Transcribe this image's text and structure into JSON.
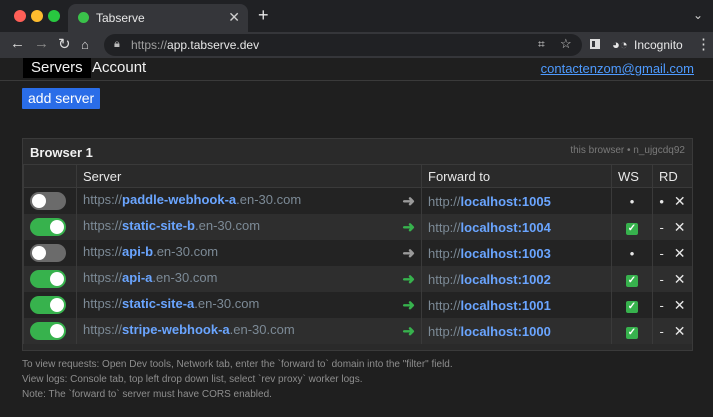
{
  "browser": {
    "tab_title": "Tabserve",
    "tab_close": "✕",
    "new_tab": "+",
    "url_scheme": "https://",
    "url_host": "app.tabserve.dev",
    "incognito_label": "Incognito",
    "traffic_colors": [
      "#ff5f57",
      "#febc2e",
      "#28c840"
    ]
  },
  "nav": {
    "servers": "Servers",
    "account": "Account",
    "email": "contactenzom@gmail.com"
  },
  "add_server": "add server",
  "panel": {
    "title": "Browser 1",
    "meta": "this browser • n_ujgcdq92",
    "headers": {
      "server": "Server",
      "forward": "Forward to",
      "ws": "WS",
      "rd": "RD"
    },
    "rows": [
      {
        "enabled": false,
        "scheme": "https://",
        "sub": "paddle-webhook-a",
        "domain": ".en-30.com",
        "fwd_scheme": "http://",
        "fwd_host": "localhost:1005",
        "ws": "•",
        "rd": "•"
      },
      {
        "enabled": true,
        "scheme": "https://",
        "sub": "static-site-b",
        "domain": ".en-30.com",
        "fwd_scheme": "http://",
        "fwd_host": "localhost:1004",
        "ws": "check",
        "rd": "-"
      },
      {
        "enabled": false,
        "scheme": "https://",
        "sub": "api-b",
        "domain": ".en-30.com",
        "fwd_scheme": "http://",
        "fwd_host": "localhost:1003",
        "ws": "•",
        "rd": "-"
      },
      {
        "enabled": true,
        "scheme": "https://",
        "sub": "api-a",
        "domain": ".en-30.com",
        "fwd_scheme": "http://",
        "fwd_host": "localhost:1002",
        "ws": "check",
        "rd": "-"
      },
      {
        "enabled": true,
        "scheme": "https://",
        "sub": "static-site-a",
        "domain": ".en-30.com",
        "fwd_scheme": "http://",
        "fwd_host": "localhost:1001",
        "ws": "check",
        "rd": "-"
      },
      {
        "enabled": true,
        "scheme": "https://",
        "sub": "stripe-webhook-a",
        "domain": ".en-30.com",
        "fwd_scheme": "http://",
        "fwd_host": "localhost:1000",
        "ws": "check",
        "rd": "-"
      }
    ]
  },
  "notes": [
    "To view requests: Open Dev tools, Network tab, enter the `forward to` domain into the \"filter\" field.",
    "View logs: Console tab, top left drop down list, select `rev proxy` worker logs.",
    "Note: The `forward to` server must have CORS enabled."
  ],
  "colors": {
    "toggle_on": "#37b24d",
    "toggle_off": "#6b6b6b",
    "arrow_on": "#37b24d",
    "arrow_off": "#9a9a9a",
    "link": "#6aa5ff",
    "button": "#2a6de8"
  },
  "icons": {
    "back": "arrow-left-icon",
    "forward": "arrow-right-icon",
    "reload": "reload-icon",
    "home": "home-icon",
    "lock": "lock-icon",
    "qr": "qr-code-icon",
    "bookmark": "star-icon",
    "side_panel": "side-panel-icon",
    "incognito": "incognito-icon",
    "menu": "kebab-menu-icon",
    "row_arrow": "arrow-right-icon",
    "delete": "close-icon"
  }
}
